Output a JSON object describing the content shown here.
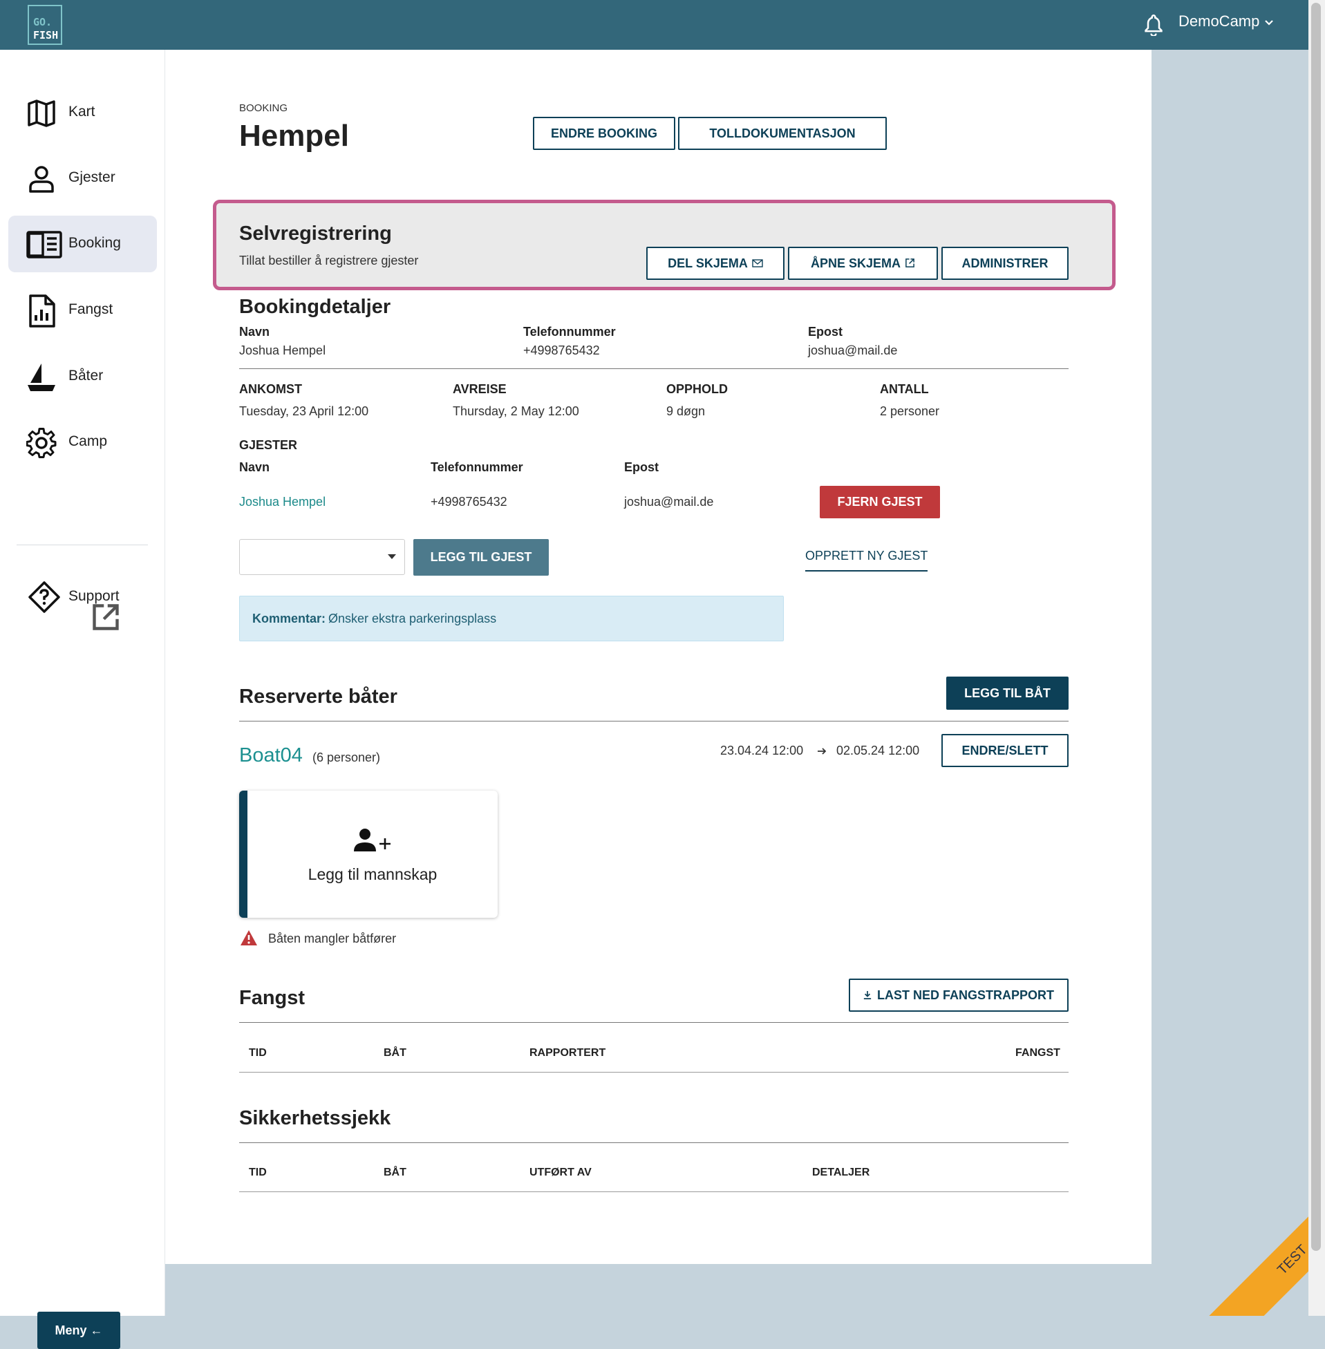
{
  "header": {
    "logo_line1": "GO.",
    "logo_line2": "FISH",
    "user": "DemoCamp"
  },
  "sidebar": {
    "items": [
      {
        "label": "Kart",
        "icon": "map-icon"
      },
      {
        "label": "Gjester",
        "icon": "person-icon"
      },
      {
        "label": "Booking",
        "icon": "booking-icon"
      },
      {
        "label": "Fangst",
        "icon": "chart-document-icon"
      },
      {
        "label": "Båter",
        "icon": "boat-icon"
      },
      {
        "label": "Camp",
        "icon": "gear-icon"
      }
    ],
    "support": "Support",
    "menu": "Meny"
  },
  "page": {
    "breadcrumb": "BOOKING",
    "title": "Hempel",
    "edit_booking": "ENDRE BOOKING",
    "customs": "TOLLDOKUMENTASJON"
  },
  "selfreg": {
    "title": "Selvregistrering",
    "subtitle": "Tillat bestiller å registrere gjester",
    "share": "DEL SKJEMA",
    "open": "ÅPNE SKJEMA",
    "admin": "ADMINISTRER"
  },
  "details": {
    "title": "Bookingdetaljer",
    "name_label": "Navn",
    "name": "Joshua Hempel",
    "phone_label": "Telefonnummer",
    "phone": "+4998765432",
    "email_label": "Epost",
    "email": "joshua@mail.de",
    "arrival_label": "ANKOMST",
    "arrival": "Tuesday, 23 April 12:00",
    "departure_label": "AVREISE",
    "departure": "Thursday, 2 May 12:00",
    "stay_label": "OPPHOLD",
    "stay": "9 døgn",
    "count_label": "ANTALL",
    "count": "2 personer"
  },
  "guests": {
    "title": "GJESTER",
    "col_name": "Navn",
    "col_phone": "Telefonnummer",
    "col_email": "Epost",
    "rows": [
      {
        "name": "Joshua Hempel",
        "phone": "+4998765432",
        "email": "joshua@mail.de",
        "remove": "FJERN GJEST"
      }
    ],
    "select_value": "",
    "add": "LEGG TIL GJEST",
    "create": "OPPRETT NY GJEST"
  },
  "comment": {
    "label": "Kommentar:",
    "text": "Ønsker ekstra parkeringsplass"
  },
  "boats": {
    "title": "Reserverte båter",
    "add": "LEGG TIL BÅT",
    "items": [
      {
        "name": "Boat04",
        "capacity": "(6 personer)",
        "from": "23.04.24 12:00",
        "to": "02.05.24 12:00",
        "edit": "ENDRE/SLETT",
        "add_crew": "Legg til mannskap",
        "warning": "Båten mangler båtfører"
      }
    ]
  },
  "catch": {
    "title": "Fangst",
    "download": "LAST NED FANGSTRAPPORT",
    "cols": [
      "TID",
      "BÅT",
      "RAPPORTERT",
      "FANGST"
    ]
  },
  "safety": {
    "title": "Sikkerhetssjekk",
    "cols": [
      "TID",
      "BÅT",
      "UTFØRT AV",
      "DETALJER"
    ]
  },
  "ribbon": "TEST",
  "colors": {
    "header": "#33677a",
    "primary": "#0d4057",
    "danger": "#c0393b",
    "highlight": "#c45b8d",
    "link": "#1c8a8a"
  }
}
